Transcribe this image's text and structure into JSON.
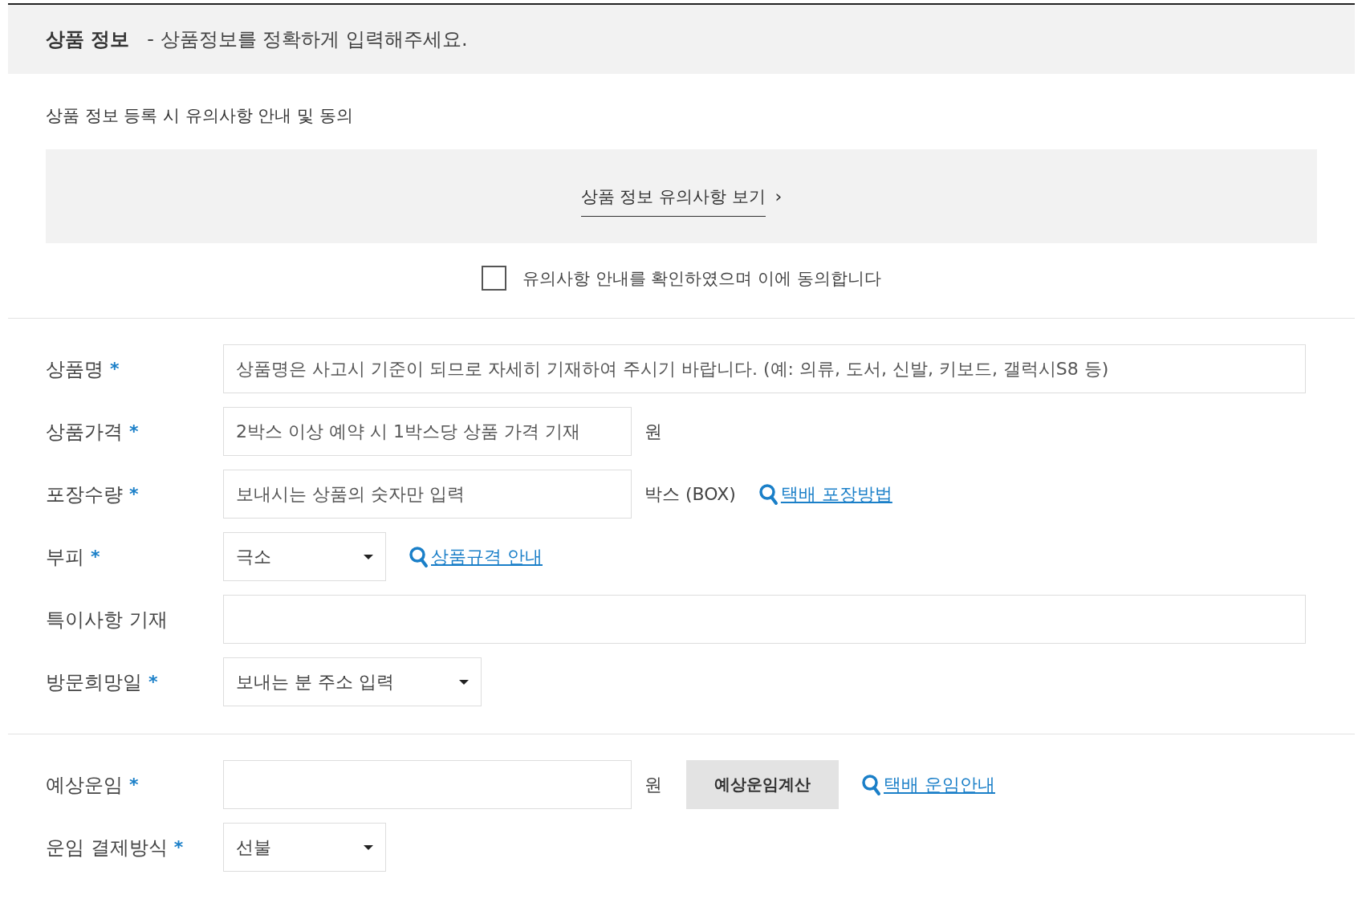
{
  "header": {
    "title": "상품 정보",
    "subtitle": "- 상품정보를 정확하게 입력해주세요."
  },
  "notice": {
    "heading": "상품 정보 등록 시 유의사항 안내 및 동의",
    "link": "상품 정보 유의사항 보기",
    "chevron": "›",
    "agreement": {
      "label": "유의사항 안내를 확인하였으며 이에 동의합니다",
      "checked": false
    }
  },
  "sections": [
    {
      "fields": [
        {
          "kind": "wide",
          "label": "상품명",
          "required_mark": "*",
          "placeholder": "상품명은 사고시 기준이 되므로 자세히 기재하여 주시기 바랍니다. (예: 의류, 도서, 신발, 키보드, 갤럭시S8 등)"
        },
        {
          "kind": "input",
          "label": "상품가격",
          "required_mark": "*",
          "placeholder": "2박스 이상 예약 시 1박스당 상품 가격 기재",
          "unit": "원"
        },
        {
          "kind": "input",
          "label": "포장수량",
          "required_mark": "*",
          "placeholder": "보내시는 상품의 숫자만 입력",
          "unit": "박스 (BOX)",
          "link": "택배 포장방법"
        },
        {
          "kind": "select",
          "label": "부피",
          "required_mark": "*",
          "value": "극소",
          "link": "상품규격 안내"
        },
        {
          "kind": "wide",
          "label": "특이사항 기재"
        },
        {
          "kind": "select-wide",
          "label": "방문희망일",
          "required_mark": "*",
          "value": "보내는 분 주소 입력"
        }
      ]
    },
    {
      "fields": [
        {
          "kind": "input",
          "label": "예상운임",
          "required_mark": "*",
          "unit": "원",
          "button": "예상운임계산",
          "link": "택배 운임안내"
        },
        {
          "kind": "select",
          "label": "운임 결제방식",
          "required_mark": "*",
          "value": "선불"
        }
      ]
    }
  ]
}
